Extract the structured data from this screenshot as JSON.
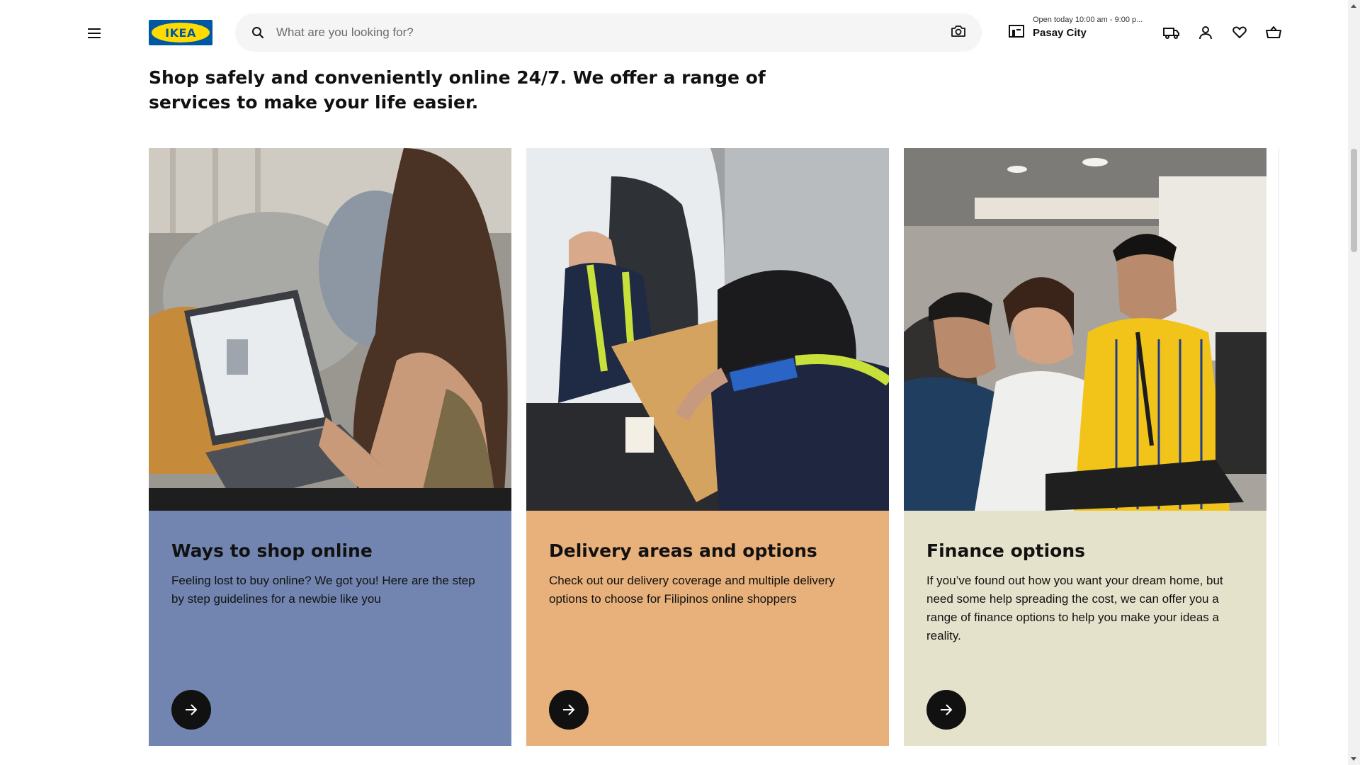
{
  "header": {
    "menu_icon": "hamburger-menu-icon",
    "logo_text": "IKEA",
    "search": {
      "placeholder": "What are you looking for?",
      "search_icon": "search-icon",
      "camera_icon": "camera-icon"
    },
    "store": {
      "hours": "Open today 10:00 am - 9:00 p...",
      "city": "Pasay City",
      "icon": "store-icon"
    },
    "icons": [
      "delivery-truck-icon",
      "account-icon",
      "heart-icon",
      "basket-icon"
    ]
  },
  "intro": {
    "text": "Shop safely and conveniently online 24/7. We offer a range of services to make your life easier."
  },
  "cards": [
    {
      "title": "Ways to shop online",
      "description": "Feeling lost to buy online? We got you! Here are the step by step guidelines for a newbie like you",
      "color": "#7285b0"
    },
    {
      "title": "Delivery areas and options",
      "description": "Check out our delivery coverage and multiple delivery options to choose for Filipinos online shoppers",
      "color": "#e8b07a"
    },
    {
      "title": "Finance options",
      "description": "If you’ve found out how you want your dream home, but need some help spreading the cost, we can offer you a range of finance options to help you make your ideas a reality.",
      "color": "#e5e2cb"
    }
  ],
  "colors": {
    "brand_blue": "#0058a3",
    "brand_yellow": "#ffdb00",
    "arrow_button": "#111111"
  }
}
